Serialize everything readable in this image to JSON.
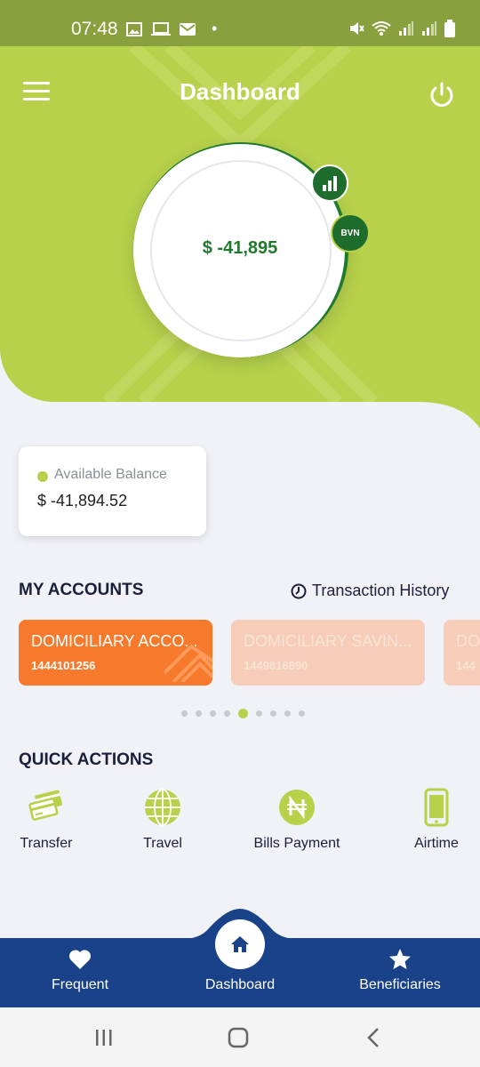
{
  "status_bar": {
    "time": "07:48",
    "dot": "•"
  },
  "header": {
    "title": "Dashboard"
  },
  "balance_ring": {
    "amount": "$ -41,895",
    "bvn_label": "BVN"
  },
  "available_balance": {
    "label": "Available Balance",
    "value": "$ -41,894.52"
  },
  "my_accounts": {
    "title": "MY ACCOUNTS",
    "history_link": "Transaction History",
    "cards": [
      {
        "name": "DOMICILIARY ACCO...",
        "number": "1444101256"
      },
      {
        "name": "DOMICILIARY SAVIN...",
        "number": "1449816890"
      },
      {
        "name": "DO",
        "number": "144"
      }
    ],
    "pager": {
      "count": 9,
      "active_index": 4
    }
  },
  "quick_actions": {
    "title": "QUICK ACTIONS",
    "items": [
      {
        "label": "Transfer",
        "icon": "cards-icon"
      },
      {
        "label": "Travel",
        "icon": "globe-icon"
      },
      {
        "label": "Bills Payment",
        "icon": "naira-icon"
      },
      {
        "label": "Airtime",
        "icon": "phone-icon"
      }
    ]
  },
  "bottom_nav": {
    "items": [
      {
        "label": "Frequent",
        "icon": "heart-icon"
      },
      {
        "label": "Dashboard",
        "icon": "home-icon"
      },
      {
        "label": "Beneficiaries",
        "icon": "star-icon"
      }
    ]
  },
  "colors": {
    "lime": "#b7d14b",
    "status_olive": "#8a9f3d",
    "dark_green": "#1f6d2c",
    "orange": "#f7792b",
    "navy": "#1a4289",
    "ink": "#1a1f3b"
  }
}
